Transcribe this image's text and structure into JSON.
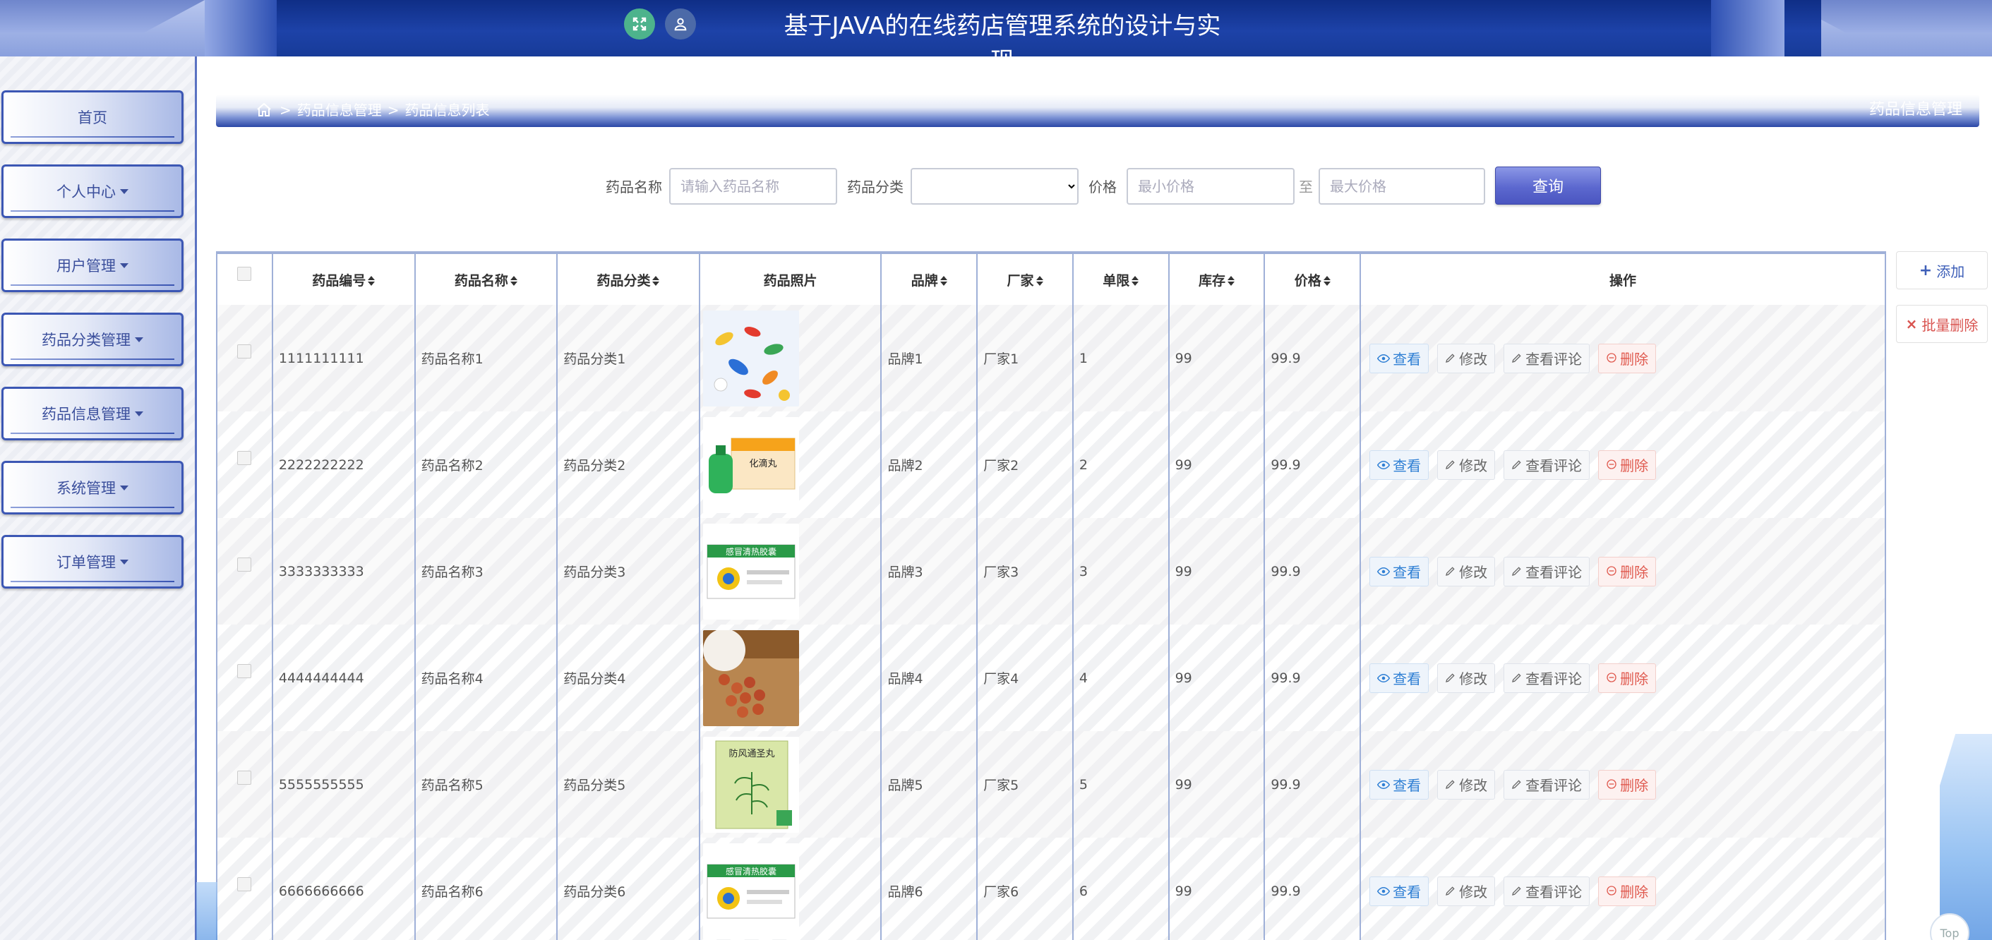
{
  "header": {
    "title": "基于JAVA的在线药店管理系统的设计与实现",
    "fullscreen_icon": "fullscreen-icon",
    "user_icon": "user-icon"
  },
  "sidebar": {
    "items": [
      {
        "label": "首页",
        "dropdown": false
      },
      {
        "label": "个人中心",
        "dropdown": true
      },
      {
        "label": "用户管理",
        "dropdown": true
      },
      {
        "label": "药品分类管理",
        "dropdown": true
      },
      {
        "label": "药品信息管理",
        "dropdown": true
      },
      {
        "label": "系统管理",
        "dropdown": true
      },
      {
        "label": "订单管理",
        "dropdown": true
      }
    ]
  },
  "breadcrumb": {
    "sep": ">",
    "level1": "药品信息管理",
    "level2": "药品信息列表",
    "right_title": "药品信息管理"
  },
  "search": {
    "name_label": "药品名称",
    "name_placeholder": "请输入药品名称",
    "category_label": "药品分类",
    "category_value": "",
    "price_label": "价格",
    "min_placeholder": "最小价格",
    "to_label": "至",
    "max_placeholder": "最大价格",
    "query_label": "查询"
  },
  "tools": {
    "add_label": "添加",
    "batch_delete_label": "批量删除"
  },
  "table": {
    "headers": [
      "药品编号",
      "药品名称",
      "药品分类",
      "药品照片",
      "品牌",
      "厂家",
      "单限",
      "库存",
      "价格",
      "操作"
    ],
    "actions": {
      "view": "查看",
      "edit": "修改",
      "comment": "查看评论",
      "delete": "删除"
    },
    "rows": [
      {
        "id": "1111111111",
        "name": "药品名称1",
        "category": "药品分类1",
        "brand": "品牌1",
        "maker": "厂家1",
        "limit": "1",
        "stock": "99",
        "price": "99.9",
        "photo": "colorful-pills"
      },
      {
        "id": "2222222222",
        "name": "药品名称2",
        "category": "药品分类2",
        "brand": "品牌2",
        "maker": "厂家2",
        "limit": "2",
        "stock": "99",
        "price": "99.9",
        "photo": "green-bottle-box"
      },
      {
        "id": "3333333333",
        "name": "药品名称3",
        "category": "药品分类3",
        "brand": "品牌3",
        "maker": "厂家3",
        "limit": "3",
        "stock": "99",
        "price": "99.9",
        "photo": "cold-medicine-box"
      },
      {
        "id": "4444444444",
        "name": "药品名称4",
        "category": "药品分类4",
        "brand": "品牌4",
        "maker": "厂家4",
        "limit": "4",
        "stock": "99",
        "price": "99.9",
        "photo": "brown-pills-bottle"
      },
      {
        "id": "5555555555",
        "name": "药品名称5",
        "category": "药品分类5",
        "brand": "品牌5",
        "maker": "厂家5",
        "limit": "5",
        "stock": "99",
        "price": "99.9",
        "photo": "herbal-box"
      },
      {
        "id": "6666666666",
        "name": "药品名称6",
        "category": "药品分类6",
        "brand": "品牌6",
        "maker": "厂家6",
        "limit": "6",
        "stock": "99",
        "price": "99.9",
        "photo": "cold-medicine-box"
      }
    ]
  },
  "herbal_box_text": "防风通圣丸",
  "cold_box_text": "感冒清热胶囊",
  "green_box_text": "化滴丸",
  "top_label": "Top",
  "colors": {
    "header_blue": "#1d42a8",
    "sidebar_border": "#3c57b4",
    "query_button": "#5c68cf",
    "view_blue": "#2f7fd4",
    "delete_red": "#e05a4f"
  }
}
